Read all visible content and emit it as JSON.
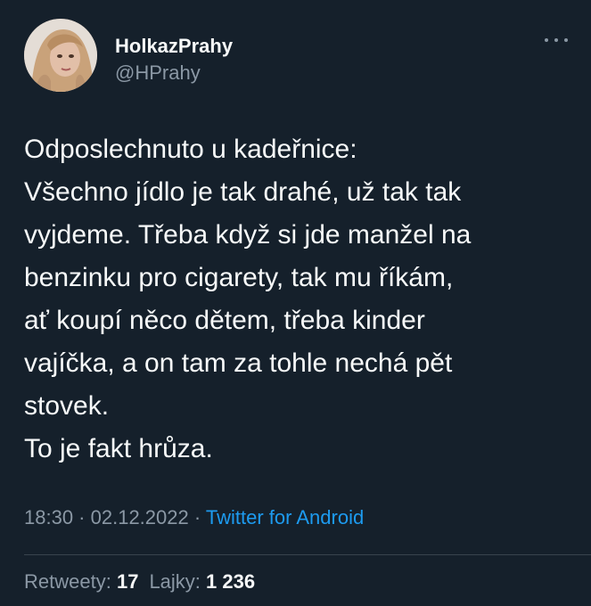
{
  "author": {
    "display_name": "HolkazPrahy",
    "handle": "@HPrahy",
    "avatar_icon": "user-avatar-photo"
  },
  "tweet": {
    "lines": [
      "Odposlechnuto u kadeřnice:",
      "Všechno jídlo je tak drahé, už tak tak",
      "vyjdeme. Třeba když si jde manžel na",
      "benzinku pro cigarety, tak mu říkám,",
      "ať koupí něco dětem, třeba kinder",
      "vajíčka, a on tam za tohle nechá pět",
      "stovek.",
      "To je fakt hrůza."
    ]
  },
  "meta": {
    "time": "18:30",
    "separator": " · ",
    "date": "02.12.2022",
    "source": "Twitter for Android"
  },
  "stats": {
    "retweets_label": "Retweety:",
    "retweets_count": "17",
    "likes_label": "Lajky:",
    "likes_count": "1 236"
  },
  "colors": {
    "background": "#15202b",
    "text_primary": "#f7f9f9",
    "text_secondary": "#8b98a5",
    "link": "#1d9bf0",
    "divider": "#38444d"
  },
  "icons": {
    "more": "more-horizontal-icon"
  }
}
